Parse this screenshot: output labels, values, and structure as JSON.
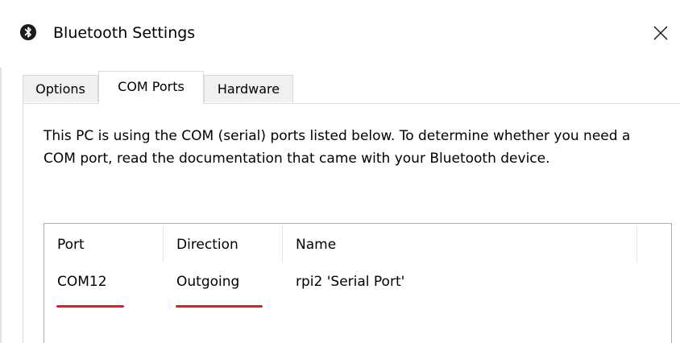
{
  "window": {
    "title": "Bluetooth Settings",
    "icon": "bluetooth-icon",
    "close_icon": "close-icon"
  },
  "tabs": [
    {
      "label": "Options",
      "active": false
    },
    {
      "label": "COM Ports",
      "active": true
    },
    {
      "label": "Hardware",
      "active": false
    }
  ],
  "com_ports": {
    "description": "This PC is using the COM (serial) ports listed below. To determine whether you need a COM port, read the documentation that came with your Bluetooth device.",
    "columns": [
      "Port",
      "Direction",
      "Name"
    ],
    "rows": [
      {
        "port": "COM12",
        "direction": "Outgoing",
        "name": "rpi2 'Serial Port'"
      }
    ]
  },
  "annotations": {
    "color": "#e02020",
    "underlined_fields": [
      "COM12",
      "Outgoing"
    ]
  }
}
